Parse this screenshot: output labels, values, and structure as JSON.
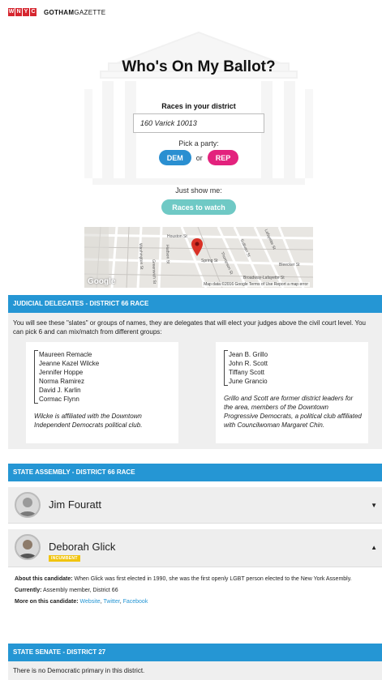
{
  "header": {
    "brand_letters": [
      "W",
      "N",
      "Y",
      "C"
    ],
    "site_bold": "GOTHAM",
    "site_rest": "GAZETTE"
  },
  "hero": {
    "title": "Who's On My Ballot?",
    "races_label": "Races in your district",
    "address_value": "160 Varick 10013",
    "party_prompt": "Pick a party:",
    "dem_label": "DEM",
    "or_label": "or",
    "rep_label": "REP",
    "show_prompt": "Just show me:",
    "watch_label": "Races to watch"
  },
  "map": {
    "google_label": "Google",
    "credits": "Map data ©2016 Google   Terms of Use   Report a map error",
    "streets": [
      "Houston St",
      "Spring St",
      "Bleecker St",
      "Broadway-Lafayette St",
      "Washington St",
      "Hudson St",
      "Greenwich St",
      "Thompson St",
      "Sullivan St",
      "Lafayette St"
    ],
    "pin_color": "#d93025"
  },
  "judicial": {
    "heading": "JUDICIAL DELEGATES - DISTRICT 66 RACE",
    "intro": "You will see these \"slates\" or groups of names, they are delegates that will elect your judges above the civil court level. You can pick 6 and can mix/match from different groups:",
    "slates": [
      {
        "names": [
          "Maureen Remacle",
          "Jeanne Kazel Wilcke",
          "Jennifer Hoppe",
          "Norma Ramirez",
          "David J. Karlin",
          "Cormac Flynn"
        ],
        "note": "Wilcke is affiliated with the Downtown Independent Democrats political club."
      },
      {
        "names": [
          "Jean B. Grillo",
          "John R. Scott",
          "Tiffany Scott",
          "June Grancio"
        ],
        "note": "Grillo and Scott are former district leaders for the area, members of the Downtown Progressive Democrats, a political club affiliated with Councilwoman Margaret Chin."
      }
    ]
  },
  "assembly": {
    "heading": "STATE ASSEMBLY - DISTRICT 66 RACE",
    "candidates": [
      {
        "name": "Jim Fouratt",
        "caret": "▼"
      },
      {
        "name": "Deborah Glick",
        "badge": "INCUMBENT",
        "caret": "▲",
        "about_label": "About this candidate:",
        "about_text": "When Glick was first elected in 1990, she was the first openly LGBT person elected to the New York Assembly.",
        "currently_label": "Currently:",
        "currently_text": "Assembly member, District 66",
        "more_label": "More on this candidate:",
        "links": [
          "Website",
          "Twitter",
          "Facebook"
        ]
      }
    ]
  },
  "senate": {
    "heading": "STATE SENATE - DISTRICT 27",
    "text": "There is no Democratic primary in this district."
  }
}
